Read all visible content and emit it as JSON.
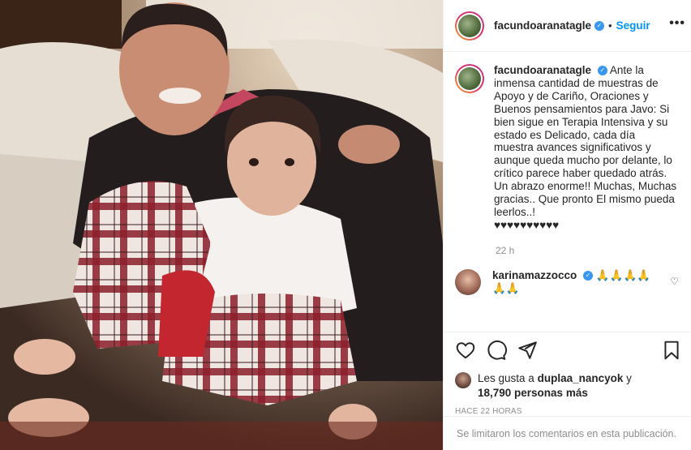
{
  "post": {
    "username": "facundoaranatagle",
    "follow_label": "Seguir",
    "dot": "•",
    "more_label": "•••",
    "verified_mark": "✓",
    "caption": "Ante la inmensa cantidad de muestras de Apoyo y de Cariño, Oraciones y Buenos pensamientos para Javo: Si bien sigue en Terapia Intensiva y su estado es Delicado, cada día muestra avances significativos y aunque queda mucho por delante, lo crítico parece haber quedado atrás.",
    "caption_2": "Un abrazo enorme!! Muchas, Muchas gracias.. Que pronto El mismo pueda leerlos..!",
    "caption_hearts": "♥♥♥♥♥♥♥♥♥♥",
    "caption_time": "22 h"
  },
  "comments": [
    {
      "username": "karinamazzocco",
      "text": "🙏🙏🙏🙏🙏🙏",
      "heart": "♡"
    }
  ],
  "actions": {
    "like_icon": "heart-outline-icon",
    "comment_icon": "comment-bubble-icon",
    "share_icon": "paper-plane-icon",
    "save_icon": "bookmark-icon"
  },
  "likes": {
    "prefix": "Les gusta a",
    "user": "duplaa_nancyok",
    "conj": "y",
    "count": "18,790 personas más"
  },
  "timestamp": "HACE 22 HORAS",
  "comments_limited": "Se limitaron los comentarios en esta publicación.",
  "colors": {
    "accent": "#0095f6",
    "text": "#262626",
    "muted": "#8e8e8e",
    "border": "#efefef"
  }
}
